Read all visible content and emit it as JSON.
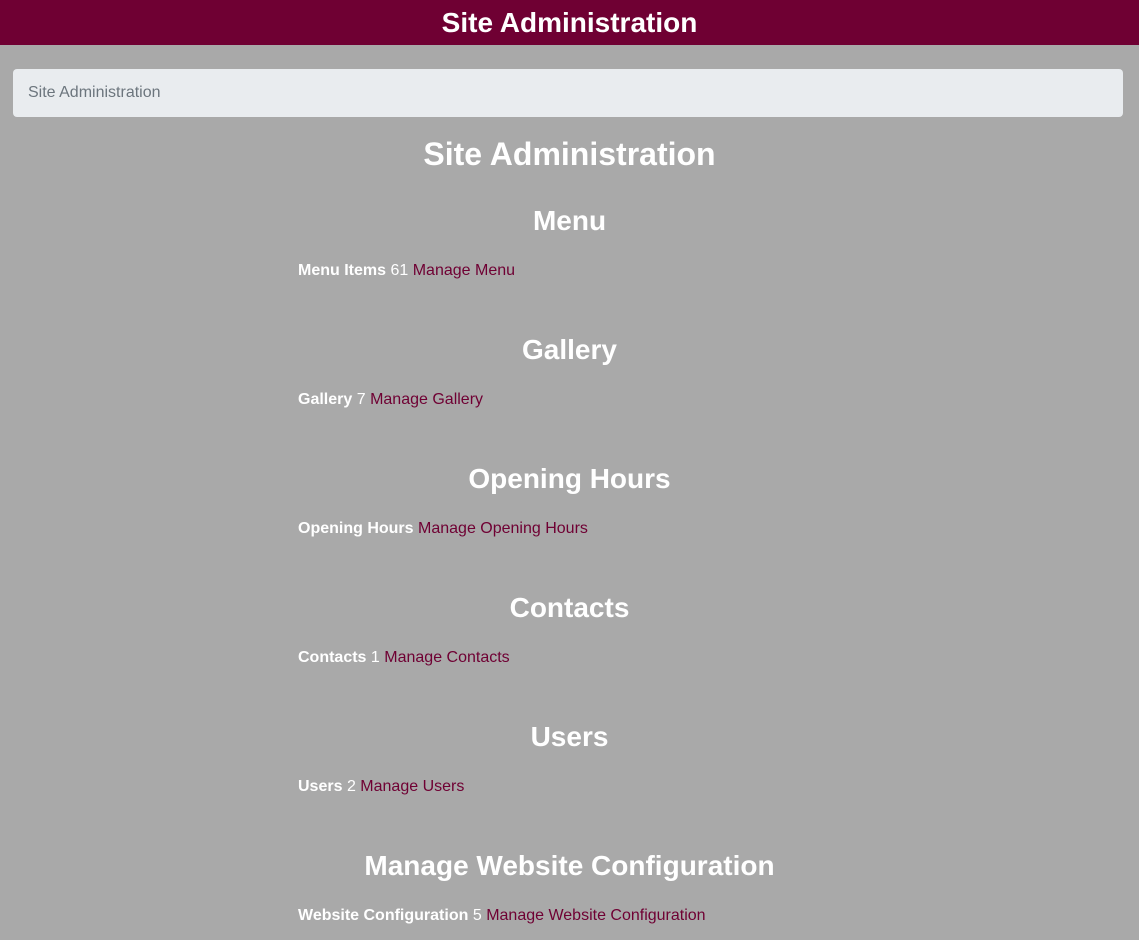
{
  "header": {
    "title": "Site Administration"
  },
  "breadcrumb": {
    "current": "Site Administration"
  },
  "page_title": "Site Administration",
  "sections": [
    {
      "heading": "Menu",
      "label": "Menu Items",
      "count": "61",
      "link": "Manage Menu"
    },
    {
      "heading": "Gallery",
      "label": "Gallery",
      "count": "7",
      "link": "Manage Gallery"
    },
    {
      "heading": "Opening Hours",
      "label": "Opening Hours",
      "count": "",
      "link": "Manage Opening Hours"
    },
    {
      "heading": "Contacts",
      "label": "Contacts",
      "count": "1",
      "link": "Manage Contacts"
    },
    {
      "heading": "Users",
      "label": "Users",
      "count": "2",
      "link": "Manage Users"
    },
    {
      "heading": "Manage Website Configuration",
      "label": "Website Configuration",
      "count": "5",
      "link": "Manage Website Configuration"
    }
  ],
  "colors": {
    "header_bg": "#6f0033",
    "page_bg": "#a9a9a9",
    "breadcrumb_bg": "#e9ecef",
    "link": "#6f0033"
  }
}
